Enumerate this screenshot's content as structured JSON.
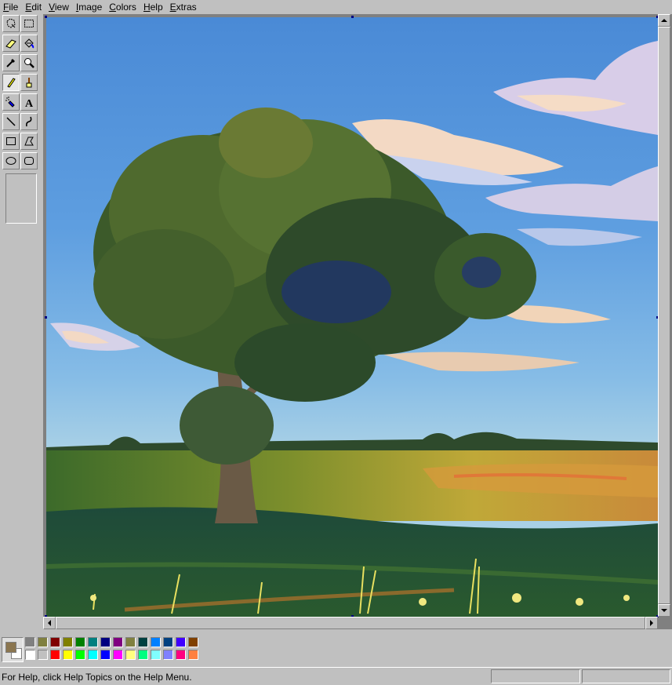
{
  "menu": [
    {
      "mnemonic": "F",
      "rest": "ile"
    },
    {
      "mnemonic": "E",
      "rest": "dit"
    },
    {
      "mnemonic": "V",
      "rest": "iew"
    },
    {
      "mnemonic": "I",
      "rest": "mage"
    },
    {
      "mnemonic": "C",
      "rest": "olors"
    },
    {
      "mnemonic": "H",
      "rest": "elp"
    },
    {
      "mnemonic": "E",
      "rest": "xtras"
    }
  ],
  "tools": [
    "free-form-select",
    "rectangle-select",
    "eraser",
    "fill-with-color",
    "pick-color",
    "magnifier",
    "pencil",
    "brush",
    "airbrush",
    "text",
    "line",
    "curve",
    "rectangle",
    "polygon",
    "ellipse",
    "rounded-rectangle"
  ],
  "selected_tool": "pencil",
  "current_colors": {
    "foreground": "#8b7650",
    "background": "#ffffff"
  },
  "palette": {
    "top": [
      "#808080",
      "#808040",
      "#800000",
      "#808000",
      "#008000",
      "#008080",
      "#000080",
      "#800080",
      "#808040",
      "#004040",
      "#0080ff",
      "#004080",
      "#4000ff",
      "#804000"
    ],
    "bottom": [
      "#ffffff",
      "#c0c0c0",
      "#ff0000",
      "#ffff00",
      "#00ff00",
      "#00ffff",
      "#0000ff",
      "#ff00ff",
      "#ffff80",
      "#00ff80",
      "#80ffff",
      "#8080ff",
      "#ff0080",
      "#ff8040"
    ]
  },
  "status": {
    "help_text": "For Help, click Help Topics on the Help Menu."
  }
}
